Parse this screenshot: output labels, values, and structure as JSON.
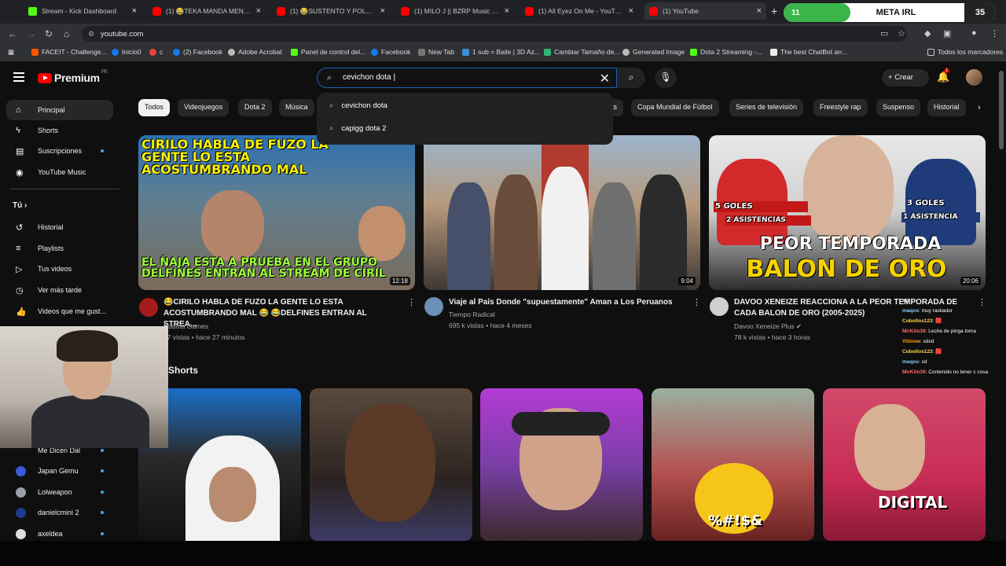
{
  "browser": {
    "tabs": [
      {
        "label": "Stream - Kick Dashboard",
        "icon": "kick"
      },
      {
        "label": "(1) 😂TEKA MANDA MENSAJE",
        "icon": "youtube"
      },
      {
        "label": "(1) 😂SUSTENTO Y POLLO DISC",
        "icon": "youtube"
      },
      {
        "label": "(1) MILO J || BZRP Music Sessio",
        "icon": "youtube"
      },
      {
        "label": "(1) All Eyez On Me - YouTube",
        "icon": "youtube"
      },
      {
        "label": "(1) YouTube",
        "icon": "youtube"
      }
    ],
    "new_tab": "+",
    "url": "youtube.com",
    "bookmarks": [
      "FACEIT - Challenge...",
      "Inicio0",
      "c",
      "(2) Facebook",
      "Adobe Acrobat",
      "Panel de control del...",
      "Facebook",
      "New Tab",
      "1 sub = Baile | 3D Az...",
      "Cambiar Tamaño de...",
      "Generated Image",
      "Dota 2 Streaming -...",
      "The best ChatBot an...",
      "Todos los marcadores"
    ]
  },
  "meta_overlay": {
    "left_value": "11",
    "title": "META IRL",
    "count": "35"
  },
  "header": {
    "brand": "Premium",
    "brand_sup": "PE",
    "search_value": "cevichon dota |",
    "create_label": "Crear",
    "notifications": "1"
  },
  "suggestions": [
    "cevichon dota",
    "capigg dota 2"
  ],
  "sidebar": {
    "main": [
      "Principal",
      "Shorts",
      "Suscripciones",
      "YouTube Music"
    ],
    "you_label": "Tú",
    "you": [
      "Historial",
      "Playlists",
      "Tus videos",
      "Ver más tarde",
      "Videos que me gust..."
    ],
    "subscriptions": [
      "Me Dicen Dal",
      "Japan Gemu",
      "Lolweapon",
      "danielcmini 2",
      "axeldea"
    ]
  },
  "chips": [
    "Todos",
    "Videojuegos",
    "Dota 2",
    "Música",
    "Copa Mundial de Fútbol",
    "Series de televisión",
    "Freestyle rap",
    "Suspenso",
    "Historial"
  ],
  "chip_partial": "ts",
  "videos": [
    {
      "title_line1": "😂CIRILO HABLA DE FUZO LA GENTE LO ESTA",
      "title_line2": "ACOSTUMBRANDO MAL 😂 😂DELFINES ENTRAN AL STREA...",
      "channel": "Rudota Games",
      "meta": "57 vistas • hace 27 minutos",
      "duration": "12:18",
      "thumb_top": "CIRILO HABLA DE FUZO LA GENTE LO ESTA ACOSTUMBRANDO MAL",
      "thumb_bottom": "EL ÑAJA ESTA A PRUEBA EN EL GRUPO DELFINES ENTRAN AL STREAM DE CIRIL"
    },
    {
      "title_line1": "Viaje al País Donde \"supuestamente\" Aman a Los Peruanos",
      "title_line2": "",
      "channel": "Tiempo Radical",
      "meta": "695 k vistas • hace 4 meses",
      "duration": "9:04",
      "thumb_top": "",
      "thumb_bottom": ""
    },
    {
      "title_line1": "DAVOO XENEIZE REACCIONA A LA PEOR TEMPORADA DE",
      "title_line2": "CADA BALON DE ORO (2005-2025)",
      "channel": "Davoo Xeneize Plus ✔",
      "meta": "78 k vistas • hace 3 horas",
      "duration": "20:06",
      "thumb_top": "PEOR TEMPORADA",
      "thumb_bottom": "BALON DE ORO",
      "badge_left_a": "5 GOLES",
      "badge_left_b": "2 ASISTENCIAS",
      "badge_right_a": "3 GOLES",
      "badge_right_b": "1 ASISTENCIA"
    }
  ],
  "shorts": {
    "title": "Shorts",
    "overlay_texts": [
      "",
      "",
      "",
      "%#!$&",
      "DIGITAL"
    ]
  },
  "chat": [
    {
      "user": "",
      "msg": "xd"
    },
    {
      "user": "maqos",
      "msg": ": muy raskador"
    },
    {
      "user": "Cobollos123",
      "msg": ": 🟥"
    },
    {
      "user": "MirKito39",
      "msg": ": Leche de pinga toma"
    },
    {
      "user": "Vitinnw",
      "msg": ": xdxd"
    },
    {
      "user": "Cobollos123",
      "msg": ": 🟥"
    },
    {
      "user": "maqos",
      "msg": ": xd"
    },
    {
      "user": "MirKito39",
      "msg": ": Contenido no tener c cosa"
    }
  ]
}
